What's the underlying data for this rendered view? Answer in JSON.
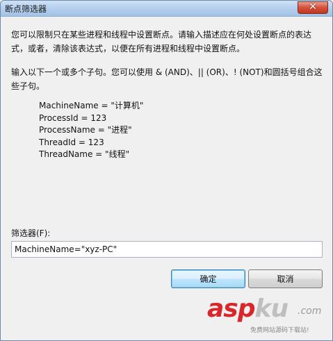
{
  "window": {
    "title": "断点筛选器",
    "close_glyph": "✕"
  },
  "description": {
    "paragraph1": "您可以限制只在某些进程和线程中设置断点。请输入描述应在何处设置断点的表达式，或者，清除该表达式，以便在所有进程和线程中设置断点。",
    "paragraph2": "输入以下一个或多个子句。您可以使用 & (AND)、|| (OR)、! (NOT)和圆括号组合这些子句。"
  },
  "examples": [
    "MachineName = \"计算机\"",
    "ProcessId = 123",
    "ProcessName = \"进程\"",
    "ThreadId = 123",
    "ThreadName = \"线程\""
  ],
  "filter": {
    "label": "筛选器(F):",
    "value": "MachineName=\"xyz-PC\""
  },
  "buttons": {
    "ok": "确定",
    "cancel": "取消"
  },
  "watermark": {
    "asp": "asp",
    "ku": "ku",
    "com": ".com",
    "subtitle": "免费网站源码下载站!"
  },
  "colors": {
    "watermark_red": "#d9262b",
    "ok_border": "#3c7fb1"
  }
}
